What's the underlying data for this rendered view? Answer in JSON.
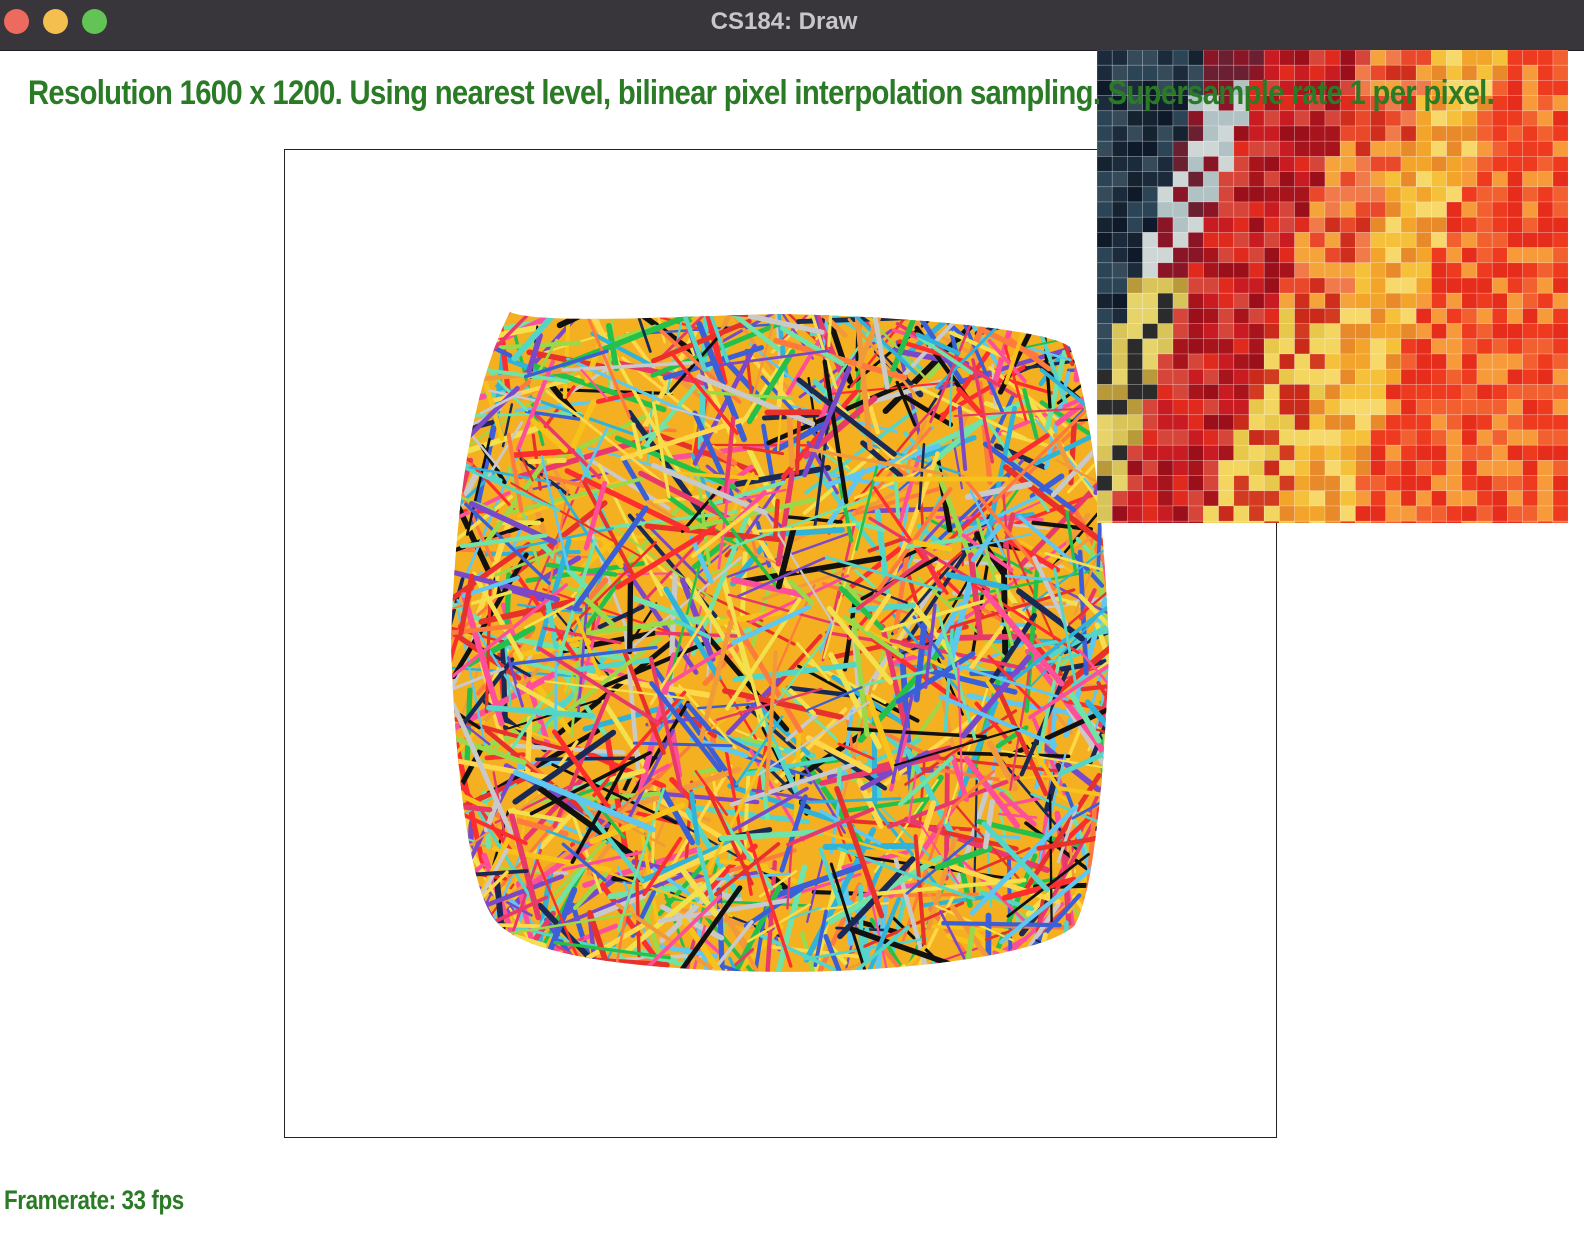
{
  "window": {
    "title": "CS184: Draw"
  },
  "overlay": {
    "status_text": "Resolution 1600 x 1200. Using nearest level, bilinear pixel interpolation sampling. Supersample rate 1 per pixel.",
    "framerate_text": "Framerate: 33 fps",
    "text_color": "#2a7a26"
  },
  "viewport": {
    "content": "textured-squircle",
    "zoom_inset": "pixel-inspector"
  },
  "icons": {
    "close": "close-button-icon",
    "minimize": "minimize-button-icon",
    "maximize": "maximize-button-icon"
  }
}
